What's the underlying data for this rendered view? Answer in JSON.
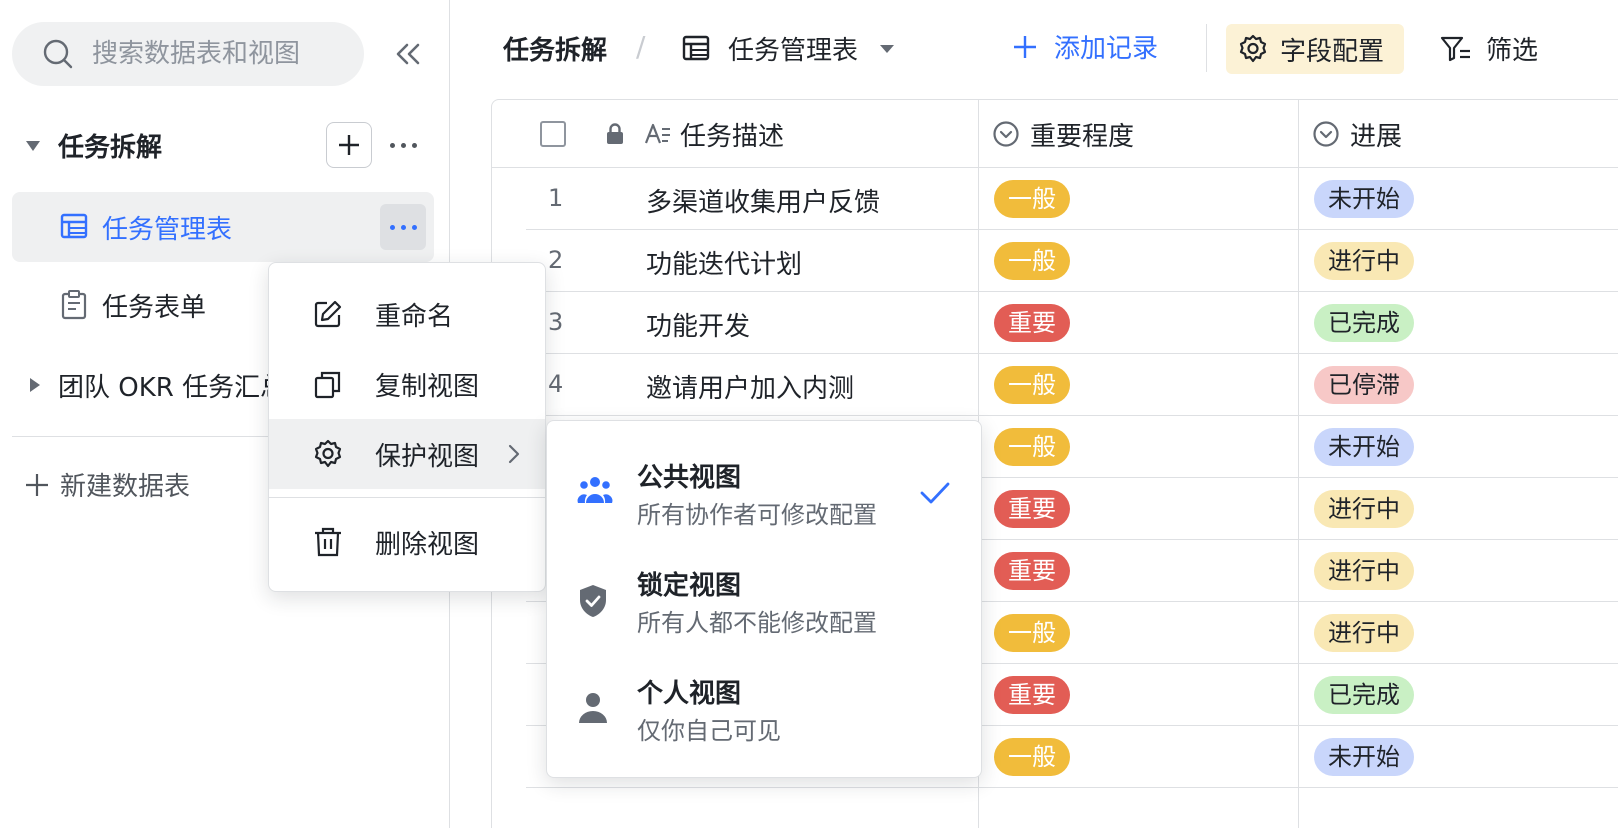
{
  "sidebar": {
    "search_placeholder": "搜索数据表和视图",
    "groups": [
      {
        "label": "任务拆解",
        "expanded": true
      },
      {
        "label": "团队 OKR 任务汇总",
        "expanded": false
      }
    ],
    "items": [
      {
        "label": "任务管理表",
        "active": true
      },
      {
        "label": "任务表单",
        "active": false
      }
    ],
    "new_table_label": "新建数据表"
  },
  "topbar": {
    "breadcrumb": "任务拆解",
    "separator": "/",
    "view_name": "任务管理表",
    "add_record": "添加记录",
    "field_config": "字段配置",
    "filter": "筛选"
  },
  "grid": {
    "columns": [
      "任务描述",
      "重要程度",
      "进展"
    ],
    "rows": [
      {
        "num": "1",
        "desc": "多渠道收集用户反馈",
        "importance": "一般",
        "progress": "未开始"
      },
      {
        "num": "2",
        "desc": "功能迭代计划",
        "importance": "一般",
        "progress": "进行中"
      },
      {
        "num": "3",
        "desc": "功能开发",
        "importance": "重要",
        "progress": "已完成"
      },
      {
        "num": "4",
        "desc": "邀请用户加入内测",
        "importance": "一般",
        "progress": "已停滞"
      },
      {
        "num": "",
        "desc": "",
        "importance": "一般",
        "progress": "未开始"
      },
      {
        "num": "",
        "desc": "",
        "importance": "重要",
        "progress": "进行中"
      },
      {
        "num": "",
        "desc": "",
        "importance": "重要",
        "progress": "进行中"
      },
      {
        "num": "",
        "desc": "",
        "importance": "一般",
        "progress": "进行中"
      },
      {
        "num": "",
        "desc": "",
        "importance": "重要",
        "progress": "已完成"
      },
      {
        "num": "",
        "desc": "",
        "importance": "一般",
        "progress": "未开始"
      }
    ],
    "tag_colors": {
      "一般": "#f1bc3b",
      "重要": "#e25d55",
      "未开始": "#c9d6fb",
      "进行中": "#f9e8b4",
      "已完成": "#c9f0c4",
      "已停滞": "#f7c8c7"
    },
    "tag_text_colors": {
      "一般": "#ffffff",
      "重要": "#ffffff",
      "未开始": "#1f2329",
      "进行中": "#1f2329",
      "已完成": "#1f2329",
      "已停滞": "#1f2329"
    }
  },
  "context_menu": {
    "items": [
      {
        "label": "重命名",
        "icon": "edit-icon"
      },
      {
        "label": "复制视图",
        "icon": "copy-icon"
      },
      {
        "label": "保护视图",
        "icon": "gear-icon",
        "has_submenu": true,
        "highlighted": true
      },
      {
        "label": "删除视图",
        "icon": "trash-icon"
      }
    ]
  },
  "submenu": {
    "items": [
      {
        "title": "公共视图",
        "desc": "所有协作者可修改配置",
        "icon": "people-icon",
        "checked": true
      },
      {
        "title": "锁定视图",
        "desc": "所有人都不能修改配置",
        "icon": "shield-check-icon",
        "checked": false
      },
      {
        "title": "个人视图",
        "desc": "仅你自己可见",
        "icon": "person-icon",
        "checked": false
      }
    ]
  },
  "colors": {
    "accent": "#3370ff",
    "text": "#1f2329",
    "secondary_text": "#646a73",
    "border": "#dee0e3",
    "highlight_bg": "#eff0f1",
    "field_config_bg": "#fcf2d6"
  }
}
